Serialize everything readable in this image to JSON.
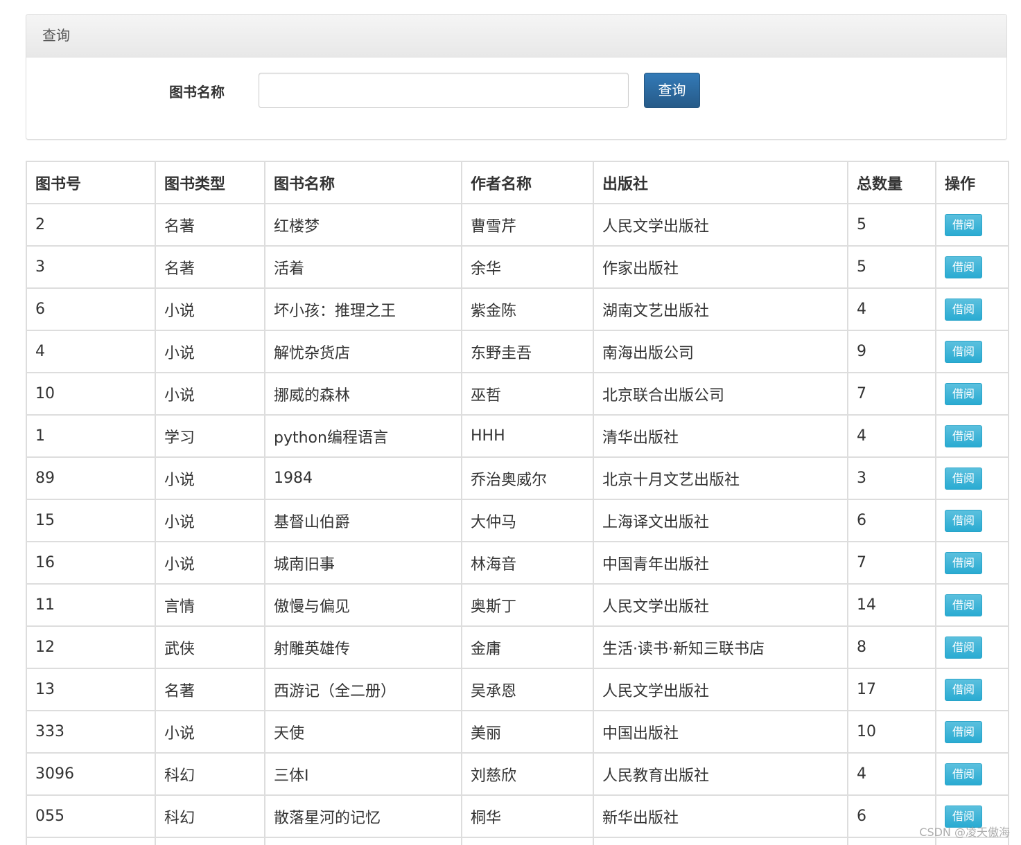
{
  "query_panel": {
    "heading": "查询",
    "field_label": "图书名称",
    "input_value": "",
    "input_placeholder": "",
    "button_label": "查询"
  },
  "table": {
    "headers": {
      "book_id": "图书号",
      "book_type": "图书类型",
      "book_name": "图书名称",
      "author": "作者名称",
      "publisher": "出版社",
      "total": "总数量",
      "action": "操作"
    },
    "borrow_label": "借阅",
    "rows": [
      {
        "book_id": "2",
        "book_type": "名著",
        "book_name": "红楼梦",
        "author": "曹雪芹",
        "publisher": "人民文学出版社",
        "total": "5"
      },
      {
        "book_id": "3",
        "book_type": "名著",
        "book_name": "活着",
        "author": "余华",
        "publisher": "作家出版社",
        "total": "5"
      },
      {
        "book_id": "6",
        "book_type": "小说",
        "book_name": "坏小孩：推理之王",
        "author": "紫金陈",
        "publisher": "湖南文艺出版社",
        "total": "4"
      },
      {
        "book_id": "4",
        "book_type": "小说",
        "book_name": "解忧杂货店",
        "author": "东野圭吾",
        "publisher": "南海出版公司",
        "total": "9"
      },
      {
        "book_id": "10",
        "book_type": "小说",
        "book_name": "挪威的森林",
        "author": "巫哲",
        "publisher": "北京联合出版公司",
        "total": "7"
      },
      {
        "book_id": "1",
        "book_type": "学习",
        "book_name": "python编程语言",
        "author": "HHH",
        "publisher": "清华出版社",
        "total": "4"
      },
      {
        "book_id": "89",
        "book_type": "小说",
        "book_name": "1984",
        "author": "乔治奥威尔",
        "publisher": "北京十月文艺出版社",
        "total": "3"
      },
      {
        "book_id": "15",
        "book_type": "小说",
        "book_name": "基督山伯爵",
        "author": "大仲马",
        "publisher": "上海译文出版社",
        "total": "6"
      },
      {
        "book_id": "16",
        "book_type": "小说",
        "book_name": "城南旧事",
        "author": "林海音",
        "publisher": "中国青年出版社",
        "total": "7"
      },
      {
        "book_id": "11",
        "book_type": "言情",
        "book_name": "傲慢与偏见",
        "author": "奥斯丁",
        "publisher": "人民文学出版社",
        "total": "14"
      },
      {
        "book_id": "12",
        "book_type": "武侠",
        "book_name": "射雕英雄传",
        "author": "金庸",
        "publisher": "生活·读书·新知三联书店",
        "total": "8"
      },
      {
        "book_id": "13",
        "book_type": "名著",
        "book_name": "西游记（全二册）",
        "author": "吴承恩",
        "publisher": "人民文学出版社",
        "total": "17"
      },
      {
        "book_id": "333",
        "book_type": "小说",
        "book_name": "天使",
        "author": "美丽",
        "publisher": "中国出版社",
        "total": "10"
      },
      {
        "book_id": "3096",
        "book_type": "科幻",
        "book_name": "三体I",
        "author": "刘慈欣",
        "publisher": "人民教育出版社",
        "total": "4"
      },
      {
        "book_id": "055",
        "book_type": "科幻",
        "book_name": "散落星河的记忆",
        "author": "桐华",
        "publisher": "新华出版社",
        "total": "6"
      }
    ]
  },
  "watermark": "CSDN @凌天傲海"
}
